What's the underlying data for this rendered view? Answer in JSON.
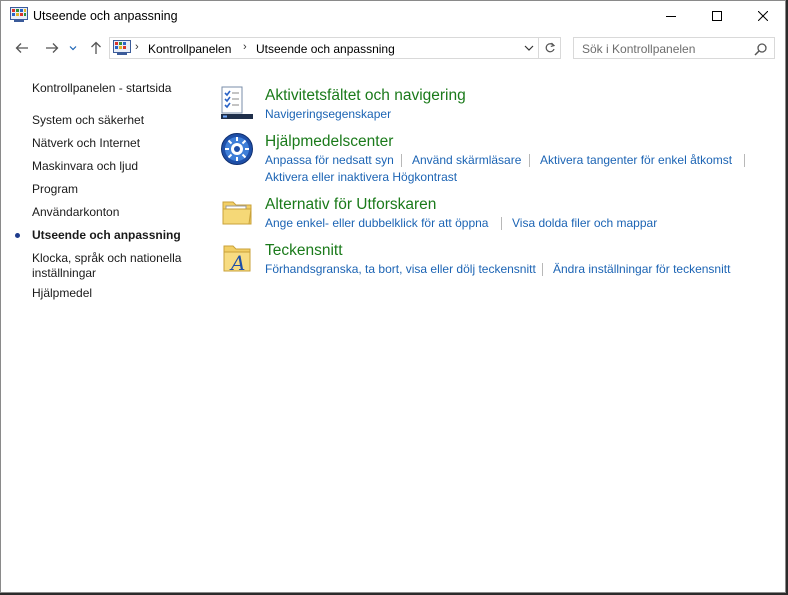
{
  "window": {
    "title": "Utseende och anpassning",
    "controls": {
      "minimize": "minimize",
      "maximize": "maximize",
      "close": "close"
    }
  },
  "navigation": {
    "back_icon": "arrow-left-icon",
    "forward_icon": "arrow-right-icon",
    "recent_icon": "chevron-down-icon",
    "up_icon": "arrow-up-icon"
  },
  "address": {
    "crumbs": [
      "Kontrollpanelen",
      "Utseende och anpassning"
    ],
    "separator": "›"
  },
  "search": {
    "placeholder": "Sök i Kontrollpanelen"
  },
  "sidebar": {
    "home": "Kontrollpanelen - startsida",
    "items": [
      {
        "label": "System och säkerhet"
      },
      {
        "label": "Nätverk och Internet"
      },
      {
        "label": "Maskinvara och ljud"
      },
      {
        "label": "Program"
      },
      {
        "label": "Användarkonton"
      },
      {
        "label": "Utseende och anpassning",
        "current": true
      },
      {
        "label": "Klocka, språk och nationella"
      },
      {
        "label": "inställningar"
      },
      {
        "label": "Hjälpmedel"
      }
    ]
  },
  "categories": [
    {
      "title": "Aktivitetsfältet och navigering",
      "icon": "taskbar-checklist-icon",
      "tasks": [
        [
          "Navigeringsegenskaper"
        ]
      ]
    },
    {
      "title": "Hjälpmedelscenter",
      "icon": "ease-of-access-icon",
      "tasks": [
        [
          "Anpassa för nedsatt syn",
          "Använd skärmläsare",
          "Aktivera tangenter för enkel åtkomst"
        ],
        [
          "Aktivera eller inaktivera Högkontrast"
        ]
      ]
    },
    {
      "title": "Alternativ för Utforskaren",
      "icon": "folder-options-icon",
      "tasks": [
        [
          "Ange enkel- eller dubbelklick för att öppna",
          "Visa dolda filer och mappar"
        ]
      ]
    },
    {
      "title": "Teckensnitt",
      "icon": "fonts-folder-icon",
      "tasks": [
        [
          "Förhandsgranska, ta bort, visa eller dölj teckensnitt",
          "Ändra inställningar för teckensnitt"
        ]
      ]
    }
  ],
  "colors": {
    "category_title": "#1a7a1a",
    "task_link": "#1c64b4",
    "current_bullet": "#1e3c8c"
  }
}
